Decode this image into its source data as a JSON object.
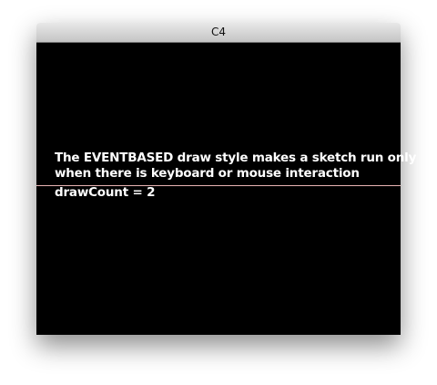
{
  "window": {
    "title": "C4"
  },
  "sketch": {
    "line1": "The EVENTBASED draw style makes a sketch run only",
    "line2": "when there is keyboard or mouse interaction",
    "draw_count": "drawCount = 2",
    "line_color": "#e8b4b4"
  }
}
